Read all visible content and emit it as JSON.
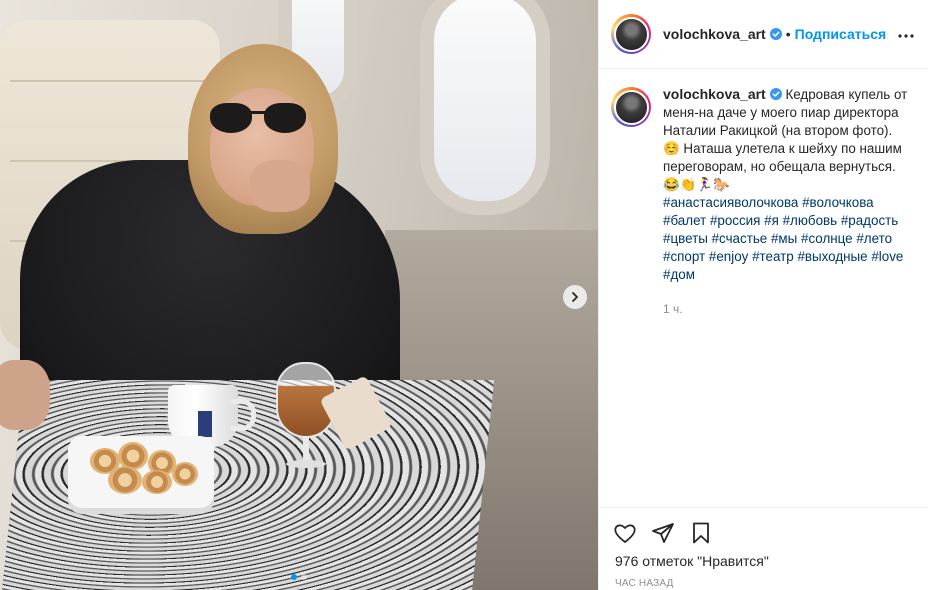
{
  "post": {
    "author": {
      "username": "volochkova_art",
      "verified": true,
      "follow_label": "Подписаться",
      "separator": "•"
    },
    "caption": {
      "text": "Кедровая купель от меня-на даче у моего пиар директора Наталии Ракицкой (на втором фото). ☺️ Наташа улетела к шейху по нашим переговорам, но обещала вернуться.😂👏🏃‍♀️🐎",
      "hashtags": [
        "#анастасияволочкова",
        "#волочкова",
        "#балет",
        "#россия",
        "#я",
        "#любовь",
        "#радость",
        "#цветы",
        "#счастье",
        "#мы",
        "#солнце",
        "#лето",
        "#спорт",
        "#enjoy",
        "#театр",
        "#выходные",
        "#love",
        "#дом"
      ],
      "age": "1 ч."
    },
    "likes_text": "976 отметок \"Нравится\"",
    "timestamp": "ЧАС НАЗАД",
    "carousel": {
      "slides": 2,
      "current": 1
    }
  },
  "icons": {
    "more": "more-horizontal-icon",
    "like": "heart-icon",
    "share": "send-icon",
    "save": "bookmark-icon",
    "next": "chevron-right-icon",
    "verified": "verified-badge-icon"
  },
  "colors": {
    "link": "#0095f6",
    "hashtag": "#00376b",
    "text": "#262626",
    "muted": "#8e8e8e"
  }
}
